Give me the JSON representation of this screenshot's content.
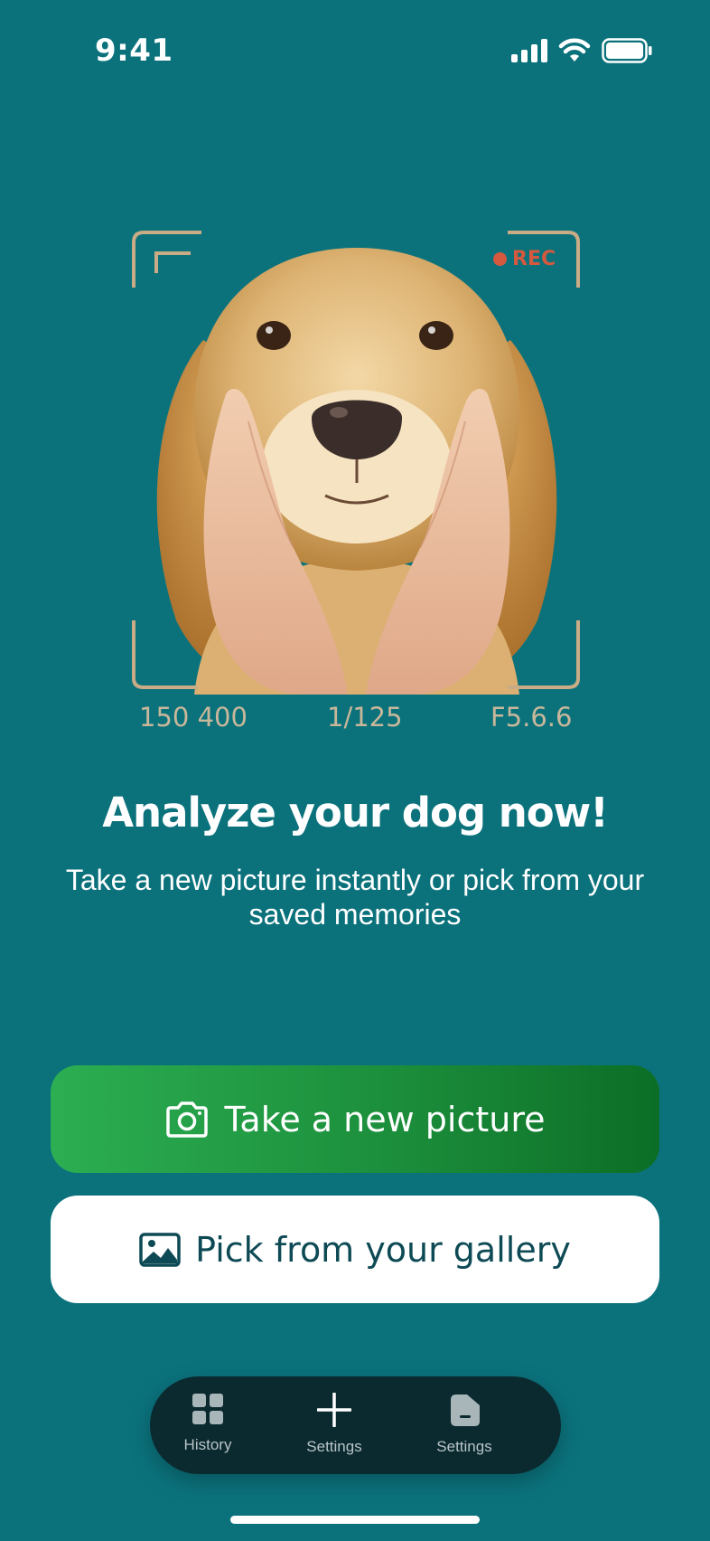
{
  "status_bar": {
    "time": "9:41",
    "icons": [
      "signal-icon",
      "wifi-icon",
      "battery-icon"
    ]
  },
  "viewfinder": {
    "rec_label": "REC",
    "readouts": {
      "iso": "150 400",
      "shutter": "1/125",
      "aperture": "F5.6.6"
    },
    "photo": "golden retriever held by hands"
  },
  "hero": {
    "title": "Analyze your dog now!",
    "subtitle": "Take a new picture instantly or pick from your saved memories"
  },
  "actions": {
    "take_picture": {
      "label": "Take a new picture",
      "icon": "camera-icon"
    },
    "pick_gallery": {
      "label": "Pick from your gallery",
      "icon": "image-icon"
    }
  },
  "tabbar": {
    "items": [
      {
        "label": "History",
        "icon": "grid-icon"
      },
      {
        "label": "Settings",
        "icon": "plus-icon"
      },
      {
        "label": "Settings",
        "icon": "folder-icon"
      }
    ]
  },
  "colors": {
    "background": "#0b727c",
    "primary_button": "#1c8f3c",
    "rec": "#d5593e",
    "readouts": "#c8b79a",
    "secondary_text": "#0e4a55",
    "tabbar": "#0b2a30"
  }
}
